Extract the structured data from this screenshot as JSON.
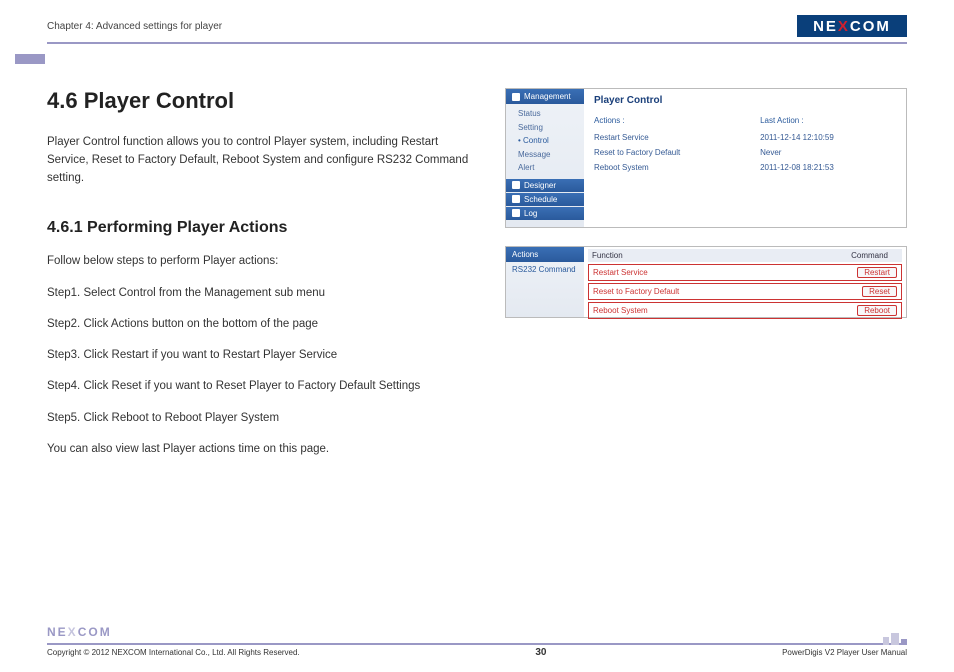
{
  "header": {
    "chapter_title": "Chapter 4: Advanced settings for player",
    "logo_parts": {
      "pre": "NE",
      "x": "X",
      "post": "COM"
    }
  },
  "main": {
    "h1": "4.6 Player Control",
    "intro": "Player Control function allows you to control Player system, including Restart Service, Reset to Factory Default, Reboot System and configure RS232 Command setting.",
    "h2": "4.6.1 Performing Player Actions",
    "lead": "Follow below steps to perform Player actions:",
    "steps": [
      "Step1. Select Control from the Management sub menu",
      "Step2. Click Actions button on the bottom of the page",
      "Step3. Click Restart if you want to Restart Player Service",
      "Step4. Click Reset if you want to Reset Player to Factory Default Settings",
      "Step5. Click Reboot to Reboot Player System"
    ],
    "trailer": "You can also view last Player actions time on this page."
  },
  "screenshot1": {
    "sidebar": {
      "management": "Management",
      "items": [
        "Status",
        "Setting",
        "Control",
        "Message",
        "Alert"
      ],
      "active_index": 2,
      "sections": [
        "Designer",
        "Schedule",
        "Log"
      ]
    },
    "panel": {
      "title": "Player Control",
      "col_labels": {
        "actions": "Actions :",
        "last": "Last Action :"
      },
      "rows": [
        {
          "action": "Restart Service",
          "last": "2011-12-14 12:10:59"
        },
        {
          "action": "Reset to Factory Default",
          "last": "Never"
        },
        {
          "action": "Reboot System",
          "last": "2011-12-08 18:21:53"
        }
      ]
    }
  },
  "screenshot2": {
    "sidebar": {
      "header": "Actions",
      "item": "RS232 Command"
    },
    "table": {
      "head": {
        "function": "Function",
        "command": "Command"
      },
      "rows": [
        {
          "function": "Restart Service",
          "button": "Restart"
        },
        {
          "function": "Reset to Factory Default",
          "button": "Reset"
        },
        {
          "function": "Reboot System",
          "button": "Reboot"
        }
      ]
    }
  },
  "footer": {
    "copyright": "Copyright © 2012 NEXCOM International Co., Ltd. All Rights Reserved.",
    "page_number": "30",
    "manual_name": "PowerDigis V2 Player User Manual"
  }
}
